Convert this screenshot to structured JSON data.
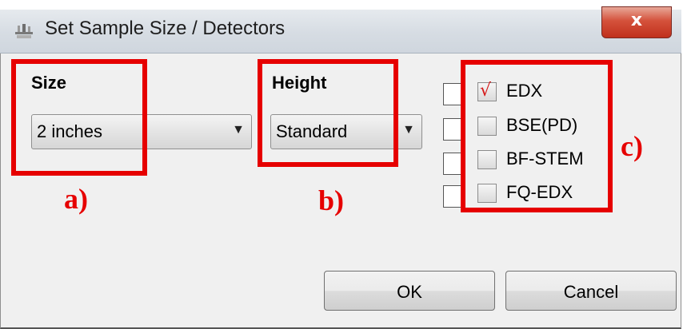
{
  "window": {
    "title": "Set Sample Size / Detectors",
    "close_glyph": "x",
    "icon": "app-icon"
  },
  "size": {
    "label": "Size",
    "value": "2 inches",
    "arrow": "▼"
  },
  "height": {
    "label": "Height",
    "value": "Standard",
    "arrow": "▼"
  },
  "detectors": [
    {
      "label": "EDX",
      "checked": true,
      "mark": "√"
    },
    {
      "label": "BSE(PD)",
      "checked": false,
      "mark": ""
    },
    {
      "label": "BF-STEM",
      "checked": false,
      "mark": ""
    },
    {
      "label": "FQ-EDX",
      "checked": false,
      "mark": ""
    }
  ],
  "buttons": {
    "ok": "OK",
    "cancel": "Cancel"
  },
  "annotations": {
    "a": "a)",
    "b": "b)",
    "c": "c)",
    "color": "#e60000"
  }
}
